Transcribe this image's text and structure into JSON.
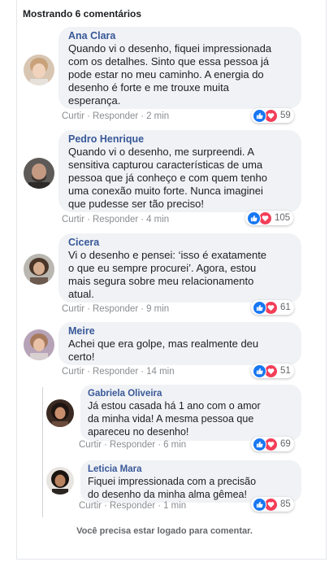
{
  "header": "Mostrando 6 comentários",
  "actions": {
    "like": "Curtir",
    "reply": "Responder",
    "dot": "·"
  },
  "comments": [
    {
      "name": "Ana Clara",
      "lines": [
        "Quando vi o desenho, fiquei impressionada",
        "com os detalhes. Sinto que essa pessoa já",
        "pode estar no meu caminho. A energia do",
        "desenho é forte e me trouxe muita",
        "esperança."
      ],
      "time": "2 min",
      "reactions": "59"
    },
    {
      "name": "Pedro Henrique",
      "lines": [
        "Quando vi o desenho, me surpreendi. A",
        "sensitiva capturou características de uma",
        "pessoa que já conheço e com quem tenho",
        "uma conexão muito forte. Nunca imaginei",
        "que pudesse ser tão preciso!"
      ],
      "time": "4 min",
      "reactions": "105"
    },
    {
      "name": "Cicera",
      "lines": [
        "Vi o desenho e pensei: ‘isso é exatamente",
        "o que eu sempre procurei’. Agora, estou",
        "mais segura sobre meu relacionamento",
        "atual."
      ],
      "time": "9 min",
      "reactions": "61"
    },
    {
      "name": "Meire",
      "lines": [
        "Achei que era golpe, mas realmente deu",
        "certo!"
      ],
      "time": "14 min",
      "reactions": "51"
    },
    {
      "name": "Gabriela Oliveira",
      "lines": [
        "Já estou casada há 1 ano com o amor",
        "da minha vida! A mesma pessoa que",
        "apareceu no desenho!"
      ],
      "time": "6 min",
      "reactions": "69"
    },
    {
      "name": "Leticia Mara",
      "lines": [
        "Fiquei impressionada com a precisão",
        "do desenho da minha alma gêmea!"
      ],
      "time": "1 min",
      "reactions": "85"
    }
  ],
  "footer": "Você precisa estar logado para comentar.",
  "colors": {
    "name": "#385898",
    "bubble": "#f0f2f5",
    "like": "#1877f2",
    "love": "#f33e58"
  }
}
